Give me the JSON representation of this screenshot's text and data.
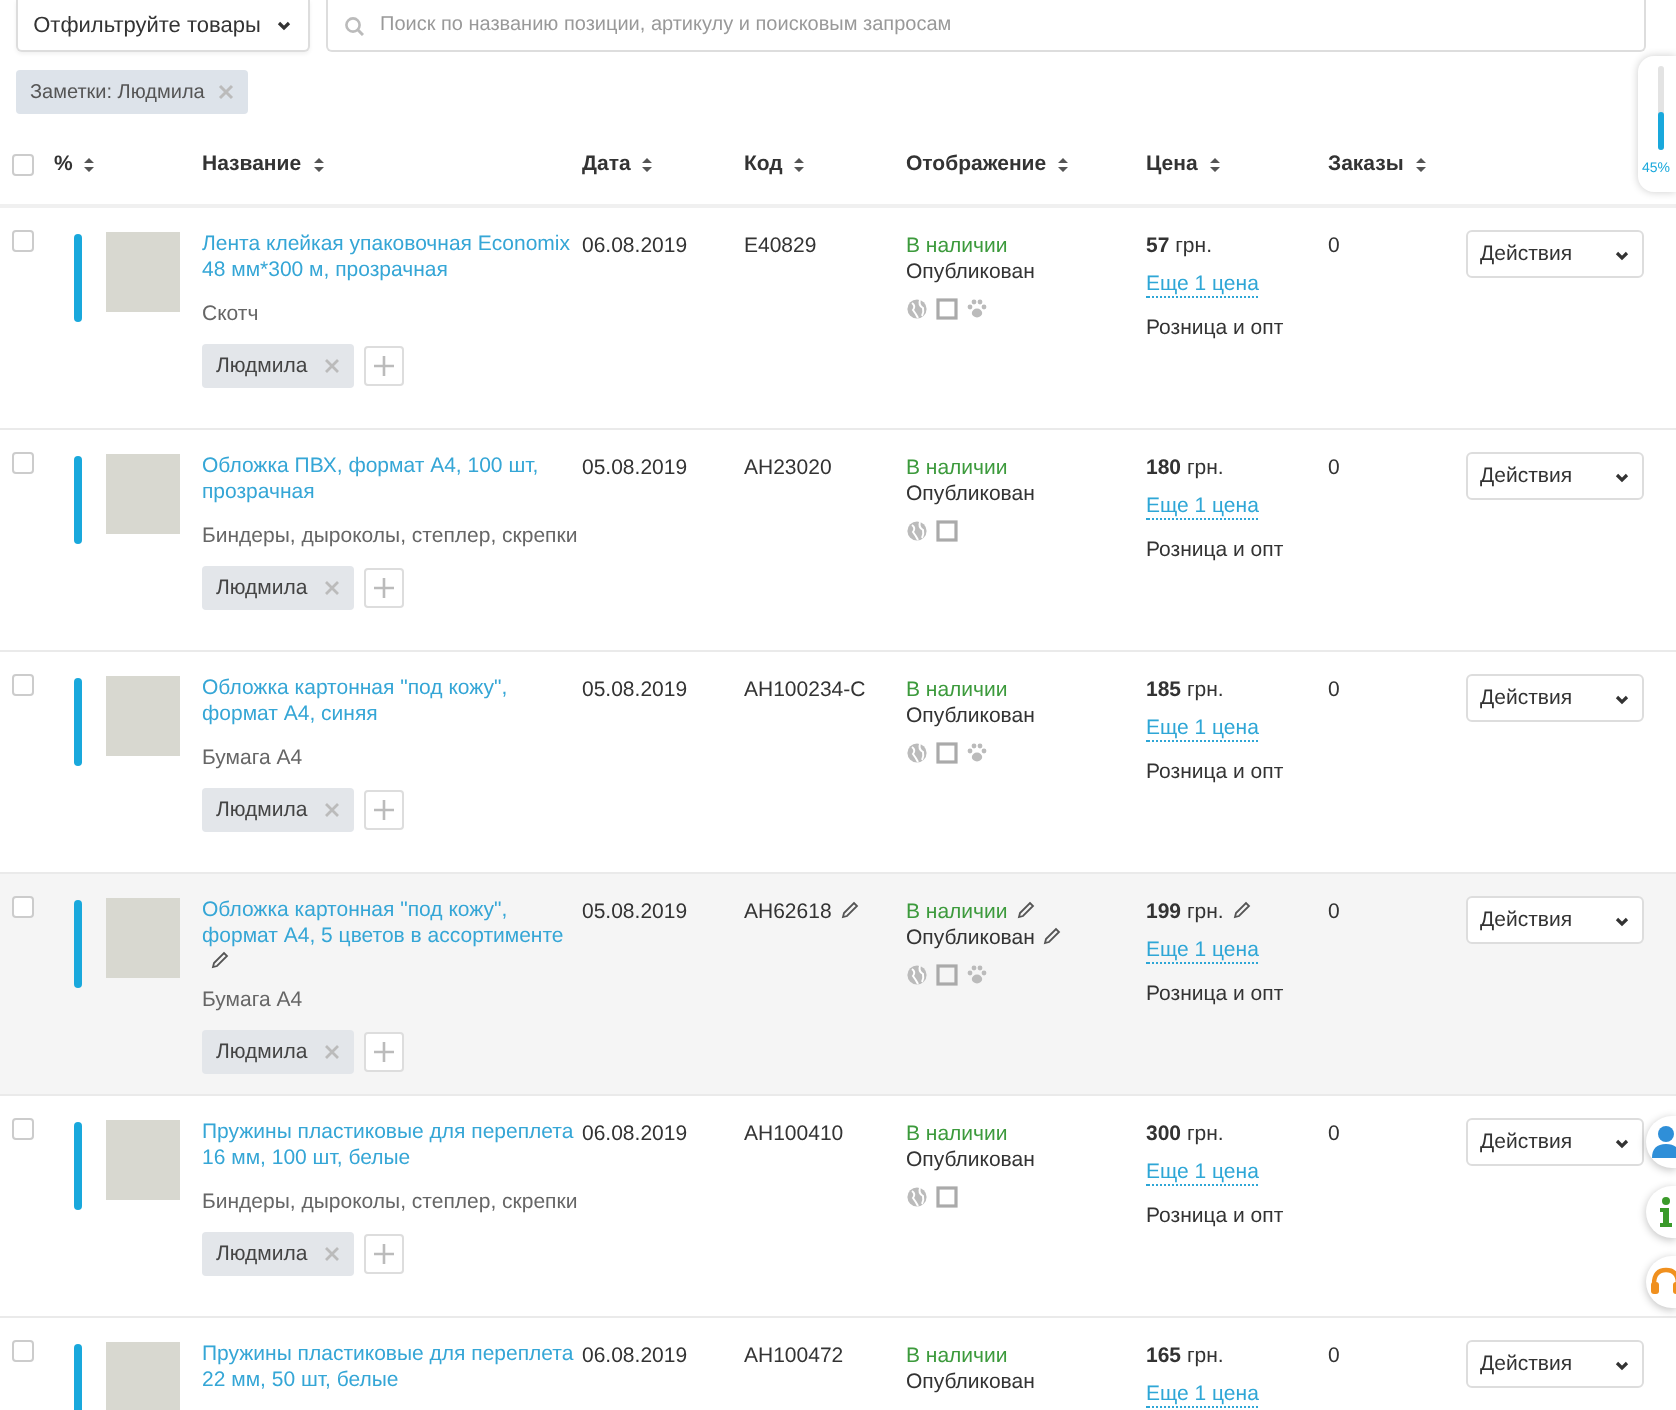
{
  "filter_button": {
    "label": "Отфильтруйте товары"
  },
  "search": {
    "placeholder": "Поиск по названию позиции, артикулу и поисковым запросам"
  },
  "active_filters": [
    {
      "label": "Заметки: Людмила"
    }
  ],
  "completeness_widget": {
    "level": 0.45,
    "label": "45%"
  },
  "table": {
    "all_selected": false,
    "columns": [
      {
        "label": "%"
      },
      {
        "label": "Название"
      },
      {
        "label": "Дата"
      },
      {
        "label": "Код"
      },
      {
        "label": "Отображение"
      },
      {
        "label": "Цена"
      },
      {
        "label": "Заказы"
      }
    ],
    "rows": [
      {
        "selected": false,
        "hovered": false,
        "title": "Лента клейкая упаковочная Economix 48 мм*300 м, прозрачная",
        "category": "Скотч",
        "tags": [
          {
            "label": "Людмила"
          }
        ],
        "date": "06.08.2019",
        "code": "E40829",
        "availability": "В наличии",
        "publication": "Опубликован",
        "channels": [
          {
            "kind": "globe"
          },
          {
            "kind": "square"
          },
          {
            "kind": "paw"
          }
        ],
        "price": "**57** грн.",
        "more_prices": "Еще 1 цена",
        "price_type": "Розница и опт",
        "orders": "0",
        "action_label": "Действия"
      },
      {
        "selected": false,
        "hovered": false,
        "title": "Обложка ПВХ, формат А4, 100 шт, прозрачная",
        "category": "Биндеры, дыроколы, степлер, скрепки",
        "tags": [
          {
            "label": "Людмила"
          }
        ],
        "date": "05.08.2019",
        "code": "AH23020",
        "availability": "В наличии",
        "publication": "Опубликован",
        "channels": [
          {
            "kind": "globe"
          },
          {
            "kind": "square"
          }
        ],
        "price": "**180** грн.",
        "more_prices": "Еще 1 цена",
        "price_type": "Розница и опт",
        "orders": "0",
        "action_label": "Действия"
      },
      {
        "selected": false,
        "hovered": false,
        "title": "Обложка картонная \"под кожу\", формат А4, синяя",
        "category": "Бумага А4",
        "tags": [
          {
            "label": "Людмила"
          }
        ],
        "date": "05.08.2019",
        "code": "AH100234-C",
        "availability": "В наличии",
        "publication": "Опубликован",
        "channels": [
          {
            "kind": "globe"
          },
          {
            "kind": "square"
          },
          {
            "kind": "paw"
          }
        ],
        "price": "**185** грн.",
        "more_prices": "Еще 1 цена",
        "price_type": "Розница и опт",
        "orders": "0",
        "action_label": "Действия"
      },
      {
        "selected": false,
        "hovered": true,
        "title": "Обложка картонная \"под кожу\", формат А4, 5 цветов в ассортименте",
        "category": "Бумага А4",
        "tags": [
          {
            "label": "Людмила"
          }
        ],
        "date": "05.08.2019",
        "code": "AH62618",
        "availability": "В наличии",
        "publication": "Опубликован",
        "channels": [
          {
            "kind": "globe"
          },
          {
            "kind": "square"
          },
          {
            "kind": "paw"
          }
        ],
        "price": "**199** грн.",
        "more_prices": "Еще 1 цена",
        "price_type": "Розница и опт",
        "orders": "0",
        "action_label": "Действия"
      },
      {
        "selected": false,
        "hovered": false,
        "title": "Пружины пластиковые для переплета 16 мм, 100 шт, белые",
        "category": "Биндеры, дыроколы, степлер, скрепки",
        "tags": [
          {
            "label": "Людмила"
          }
        ],
        "date": "06.08.2019",
        "code": "AH100410",
        "availability": "В наличии",
        "publication": "Опубликован",
        "channels": [
          {
            "kind": "globe"
          },
          {
            "kind": "square"
          }
        ],
        "price": "**300** грн.",
        "more_prices": "Еще 1 цена",
        "price_type": "Розница и опт",
        "orders": "0",
        "action_label": "Действия"
      },
      {
        "selected": false,
        "hovered": false,
        "title": "Пружины пластиковые для переплета 22 мм, 50 шт, белые",
        "date": "06.08.2019",
        "code": "AH100472",
        "availability": "В наличии",
        "publication": "Опубликован",
        "price": "**165** грн.",
        "more_prices": "Еще 1 цена",
        "orders": "0",
        "action_label": "Действия"
      }
    ]
  },
  "side_buttons": [
    {
      "kind": "user"
    },
    {
      "kind": "info"
    },
    {
      "kind": "support"
    }
  ]
}
